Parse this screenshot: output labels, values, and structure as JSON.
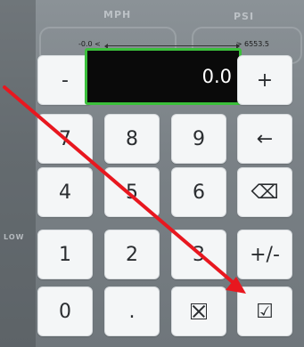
{
  "background": {
    "mph_label": "MPH",
    "psi_label": "PSI",
    "low_label": "LOW"
  },
  "range": {
    "min": "-0.0 <",
    "max": "> 6553.5"
  },
  "display": {
    "value": "0.0"
  },
  "keys": {
    "minus": "-",
    "plus": "+",
    "k7": "7",
    "k8": "8",
    "k9": "9",
    "back_arrow": "←",
    "k4": "4",
    "k5": "5",
    "k6": "6",
    "clear_symbol": "⌫",
    "k1": "1",
    "k2": "2",
    "k3": "3",
    "plus_minus": "+/-",
    "k0": "0",
    "dot": ".",
    "check": "☑"
  },
  "colors": {
    "display_border": "#3bbf3b",
    "annotation_arrow": "#e8171f"
  },
  "icons": {
    "cancel": "cancel-box-icon",
    "confirm": "checkbox-icon"
  }
}
